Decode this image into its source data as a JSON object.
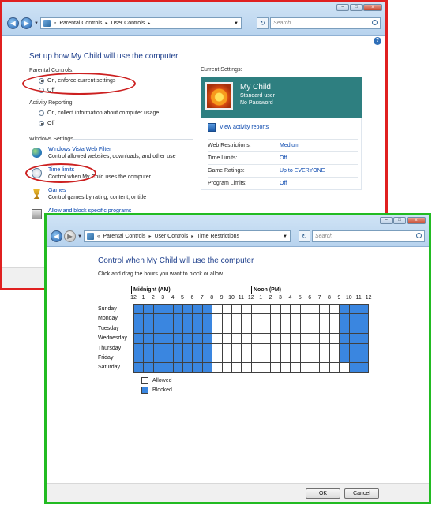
{
  "window1": {
    "breadcrumb": [
      "Parental Controls",
      "User Controls"
    ],
    "search_placeholder": "Search",
    "heading": "Set up how My Child will use the computer",
    "parental_controls_label": "Parental Controls:",
    "parental_on": "On, enforce current settings",
    "parental_off": "Off",
    "activity_label": "Activity Reporting:",
    "activity_on": "On, collect information about computer usage",
    "activity_off": "Off",
    "windows_settings_label": "Windows Settings",
    "settings": [
      {
        "title": "Windows Vista Web Filter",
        "desc": "Control allowed websites, downloads, and other use"
      },
      {
        "title": "Time limits",
        "desc": "Control when My Child uses the computer"
      },
      {
        "title": "Games",
        "desc": "Control games by rating, content, or title"
      },
      {
        "title": "Allow and block specific programs",
        "desc": ""
      }
    ],
    "current_settings_label": "Current Settings:",
    "user": {
      "name": "My Child",
      "type": "Standard user",
      "password": "No Password"
    },
    "view_reports": "View activity reports",
    "summary": [
      {
        "key": "Web Restrictions:",
        "value": "Medium"
      },
      {
        "key": "Time Limits:",
        "value": "Off"
      },
      {
        "key": "Game Ratings:",
        "value": "Up to EVERYONE"
      },
      {
        "key": "Program Limits:",
        "value": "Off"
      }
    ]
  },
  "window2": {
    "breadcrumb": [
      "Parental Controls",
      "User Controls",
      "Time Restrictions"
    ],
    "search_placeholder": "Search",
    "heading": "Control when My Child will use the computer",
    "instruction": "Click and drag the hours you want to block or allow.",
    "midnight_label": "Midnight (AM)",
    "noon_label": "Noon (PM)",
    "hours": [
      "12",
      "1",
      "2",
      "3",
      "4",
      "5",
      "6",
      "7",
      "8",
      "9",
      "10",
      "11",
      "12",
      "1",
      "2",
      "3",
      "4",
      "5",
      "6",
      "7",
      "8",
      "9",
      "10",
      "11",
      "12"
    ],
    "days": [
      "Sunday",
      "Monday",
      "Tuesday",
      "Wednesday",
      "Thursday",
      "Friday",
      "Saturday"
    ],
    "blocked_hours": [
      0,
      1,
      2,
      3,
      4,
      5,
      6,
      7,
      21,
      22,
      23
    ],
    "saturday_allowed_hours": [
      21
    ],
    "legend_allowed": "Allowed",
    "legend_blocked": "Blocked",
    "ok_label": "OK",
    "cancel_label": "Cancel"
  },
  "colors": {
    "blocked": "#3a86e0",
    "allowed": "#ffffff",
    "accent_teal": "#2e7f80",
    "heading_blue": "#1e3f8c"
  }
}
